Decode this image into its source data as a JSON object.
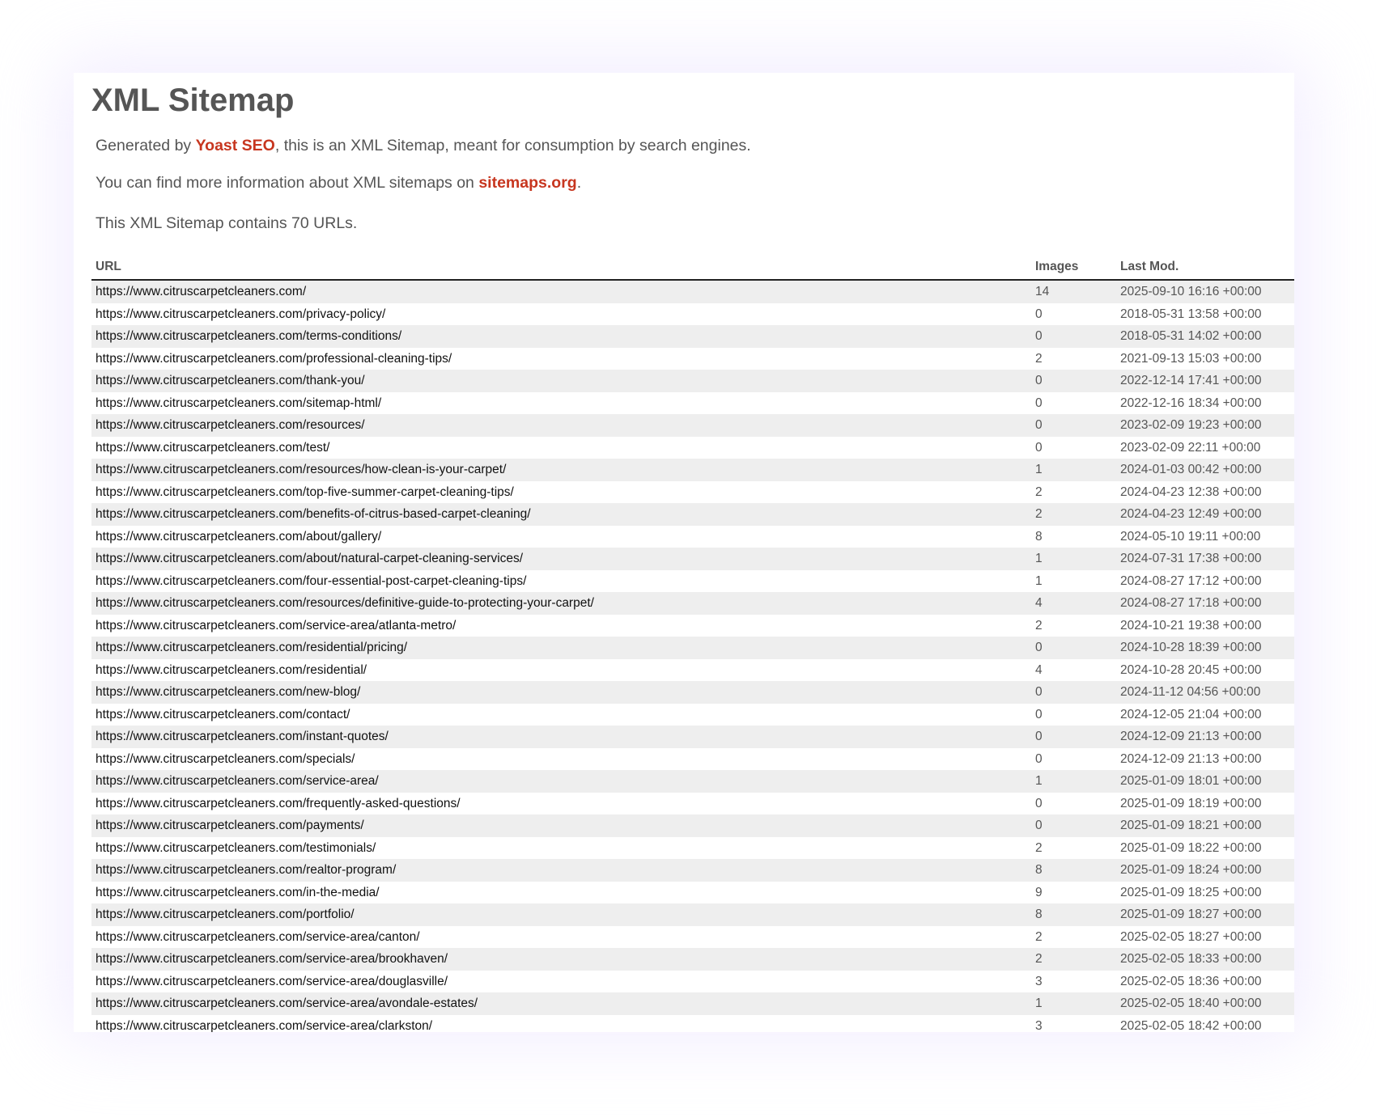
{
  "page": {
    "title": "XML Sitemap",
    "intro1_prefix": "Generated by ",
    "intro1_link": "Yoast SEO",
    "intro1_suffix": ", this is an XML Sitemap, meant for consumption by search engines.",
    "intro2_prefix": "You can find more information about XML sitemaps on ",
    "intro2_link": "sitemaps.org",
    "intro2_suffix": ".",
    "summary": "This XML Sitemap contains 70 URLs."
  },
  "colors": {
    "link": "#c7361f",
    "text": "#555555",
    "row_alt": "#eeeeee"
  },
  "table": {
    "headers": {
      "url": "URL",
      "images": "Images",
      "lastmod": "Last Mod."
    },
    "rows": [
      {
        "url": "https://www.citruscarpetcleaners.com/",
        "images": "14",
        "lastmod": "2025-09-10 16:16 +00:00"
      },
      {
        "url": "https://www.citruscarpetcleaners.com/privacy-policy/",
        "images": "0",
        "lastmod": "2018-05-31 13:58 +00:00"
      },
      {
        "url": "https://www.citruscarpetcleaners.com/terms-conditions/",
        "images": "0",
        "lastmod": "2018-05-31 14:02 +00:00"
      },
      {
        "url": "https://www.citruscarpetcleaners.com/professional-cleaning-tips/",
        "images": "2",
        "lastmod": "2021-09-13 15:03 +00:00"
      },
      {
        "url": "https://www.citruscarpetcleaners.com/thank-you/",
        "images": "0",
        "lastmod": "2022-12-14 17:41 +00:00"
      },
      {
        "url": "https://www.citruscarpetcleaners.com/sitemap-html/",
        "images": "0",
        "lastmod": "2022-12-16 18:34 +00:00"
      },
      {
        "url": "https://www.citruscarpetcleaners.com/resources/",
        "images": "0",
        "lastmod": "2023-02-09 19:23 +00:00"
      },
      {
        "url": "https://www.citruscarpetcleaners.com/test/",
        "images": "0",
        "lastmod": "2023-02-09 22:11 +00:00"
      },
      {
        "url": "https://www.citruscarpetcleaners.com/resources/how-clean-is-your-carpet/",
        "images": "1",
        "lastmod": "2024-01-03 00:42 +00:00"
      },
      {
        "url": "https://www.citruscarpetcleaners.com/top-five-summer-carpet-cleaning-tips/",
        "images": "2",
        "lastmod": "2024-04-23 12:38 +00:00"
      },
      {
        "url": "https://www.citruscarpetcleaners.com/benefits-of-citrus-based-carpet-cleaning/",
        "images": "2",
        "lastmod": "2024-04-23 12:49 +00:00"
      },
      {
        "url": "https://www.citruscarpetcleaners.com/about/gallery/",
        "images": "8",
        "lastmod": "2024-05-10 19:11 +00:00"
      },
      {
        "url": "https://www.citruscarpetcleaners.com/about/natural-carpet-cleaning-services/",
        "images": "1",
        "lastmod": "2024-07-31 17:38 +00:00"
      },
      {
        "url": "https://www.citruscarpetcleaners.com/four-essential-post-carpet-cleaning-tips/",
        "images": "1",
        "lastmod": "2024-08-27 17:12 +00:00"
      },
      {
        "url": "https://www.citruscarpetcleaners.com/resources/definitive-guide-to-protecting-your-carpet/",
        "images": "4",
        "lastmod": "2024-08-27 17:18 +00:00"
      },
      {
        "url": "https://www.citruscarpetcleaners.com/service-area/atlanta-metro/",
        "images": "2",
        "lastmod": "2024-10-21 19:38 +00:00"
      },
      {
        "url": "https://www.citruscarpetcleaners.com/residential/pricing/",
        "images": "0",
        "lastmod": "2024-10-28 18:39 +00:00"
      },
      {
        "url": "https://www.citruscarpetcleaners.com/residential/",
        "images": "4",
        "lastmod": "2024-10-28 20:45 +00:00"
      },
      {
        "url": "https://www.citruscarpetcleaners.com/new-blog/",
        "images": "0",
        "lastmod": "2024-11-12 04:56 +00:00"
      },
      {
        "url": "https://www.citruscarpetcleaners.com/contact/",
        "images": "0",
        "lastmod": "2024-12-05 21:04 +00:00"
      },
      {
        "url": "https://www.citruscarpetcleaners.com/instant-quotes/",
        "images": "0",
        "lastmod": "2024-12-09 21:13 +00:00"
      },
      {
        "url": "https://www.citruscarpetcleaners.com/specials/",
        "images": "0",
        "lastmod": "2024-12-09 21:13 +00:00"
      },
      {
        "url": "https://www.citruscarpetcleaners.com/service-area/",
        "images": "1",
        "lastmod": "2025-01-09 18:01 +00:00"
      },
      {
        "url": "https://www.citruscarpetcleaners.com/frequently-asked-questions/",
        "images": "0",
        "lastmod": "2025-01-09 18:19 +00:00"
      },
      {
        "url": "https://www.citruscarpetcleaners.com/payments/",
        "images": "0",
        "lastmod": "2025-01-09 18:21 +00:00"
      },
      {
        "url": "https://www.citruscarpetcleaners.com/testimonials/",
        "images": "2",
        "lastmod": "2025-01-09 18:22 +00:00"
      },
      {
        "url": "https://www.citruscarpetcleaners.com/realtor-program/",
        "images": "8",
        "lastmod": "2025-01-09 18:24 +00:00"
      },
      {
        "url": "https://www.citruscarpetcleaners.com/in-the-media/",
        "images": "9",
        "lastmod": "2025-01-09 18:25 +00:00"
      },
      {
        "url": "https://www.citruscarpetcleaners.com/portfolio/",
        "images": "8",
        "lastmod": "2025-01-09 18:27 +00:00"
      },
      {
        "url": "https://www.citruscarpetcleaners.com/service-area/canton/",
        "images": "2",
        "lastmod": "2025-02-05 18:27 +00:00"
      },
      {
        "url": "https://www.citruscarpetcleaners.com/service-area/brookhaven/",
        "images": "2",
        "lastmod": "2025-02-05 18:33 +00:00"
      },
      {
        "url": "https://www.citruscarpetcleaners.com/service-area/douglasville/",
        "images": "3",
        "lastmod": "2025-02-05 18:36 +00:00"
      },
      {
        "url": "https://www.citruscarpetcleaners.com/service-area/avondale-estates/",
        "images": "1",
        "lastmod": "2025-02-05 18:40 +00:00"
      },
      {
        "url": "https://www.citruscarpetcleaners.com/service-area/clarkston/",
        "images": "3",
        "lastmod": "2025-02-05 18:42 +00:00"
      }
    ]
  }
}
